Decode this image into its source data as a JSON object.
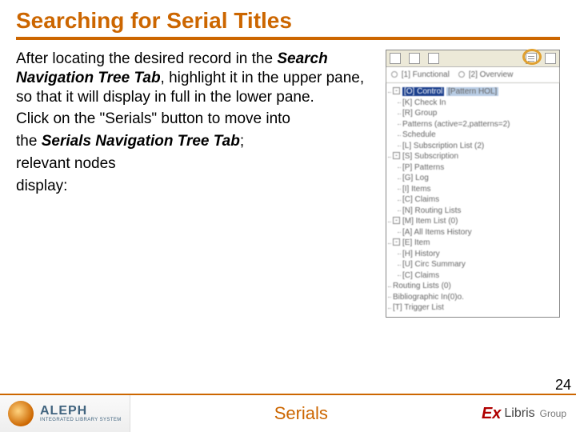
{
  "title": "Searching for Serial Titles",
  "body": {
    "p1_a": "After locating the desired record in the ",
    "p1_b": "Search Navigation Tree Tab",
    "p1_c": ", highlight it in the upper pane, so that it will display in full in the lower pane.",
    "p2_a": "Click on the \"Serials\" button to move into",
    "p3_a": "the ",
    "p3_b": "Serials Navigation Tree Tab",
    "p3_c": ";",
    "p4": "relevant nodes",
    "p5": "display:"
  },
  "panel": {
    "overview_left": "[1] Functional",
    "overview_right": "[2] Overview",
    "nodes": [
      {
        "depth": 0,
        "box": "-",
        "label": "[O] Control",
        "sel": true,
        "extra": "[Pattern HOL]",
        "extraSel": true
      },
      {
        "depth": 1,
        "box": "",
        "label": "[K] Check In"
      },
      {
        "depth": 1,
        "box": "",
        "label": "[R] Group"
      },
      {
        "depth": 1,
        "box": "",
        "label": "Patterns (active=2,patterns=2)"
      },
      {
        "depth": 1,
        "box": "",
        "label": "Schedule"
      },
      {
        "depth": 1,
        "box": "",
        "label": "[L] Subscription List (2)"
      },
      {
        "depth": 0,
        "box": "-",
        "label": "[S] Subscription"
      },
      {
        "depth": 1,
        "box": "",
        "label": "[P] Patterns"
      },
      {
        "depth": 1,
        "box": "",
        "label": "[G] Log"
      },
      {
        "depth": 1,
        "box": "",
        "label": "[I] Items"
      },
      {
        "depth": 1,
        "box": "",
        "label": "[C] Claims"
      },
      {
        "depth": 1,
        "box": "",
        "label": "[N] Routing Lists"
      },
      {
        "depth": 0,
        "box": "-",
        "label": "[M] Item List (0)"
      },
      {
        "depth": 1,
        "box": "",
        "label": "[A] All Items History"
      },
      {
        "depth": 0,
        "box": "-",
        "label": "[E] Item"
      },
      {
        "depth": 1,
        "box": "",
        "label": "[H] History"
      },
      {
        "depth": 1,
        "box": "",
        "label": "[U] Circ Summary"
      },
      {
        "depth": 1,
        "box": "",
        "label": "[C] Claims"
      },
      {
        "depth": 0,
        "box": "",
        "label": "Routing Lists (0)"
      },
      {
        "depth": 0,
        "box": "",
        "label": "Bibliographic In(0)o."
      },
      {
        "depth": 0,
        "box": "",
        "label": "[T] Trigger List"
      }
    ]
  },
  "page_number": "24",
  "footer": {
    "aleph": "ALEPH",
    "aleph_tag": "INTEGRATED LIBRARY SYSTEM",
    "mid": "Serials",
    "ex_mark": "Ex",
    "ex_text": "Libris",
    "ex_group": "Group"
  }
}
